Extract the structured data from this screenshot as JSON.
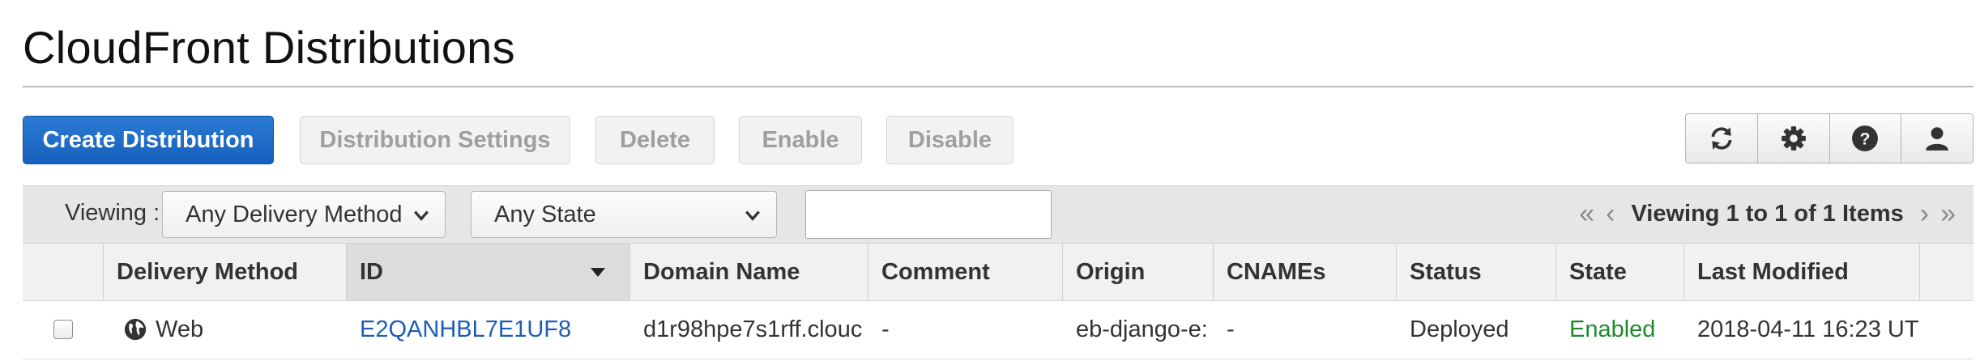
{
  "page": {
    "title": "CloudFront Distributions"
  },
  "toolbar": {
    "create_label": "Create Distribution",
    "settings_label": "Distribution Settings",
    "delete_label": "Delete",
    "enable_label": "Enable",
    "disable_label": "Disable",
    "icons": [
      "refresh-icon",
      "gear-icon",
      "help-icon",
      "user-icon"
    ]
  },
  "filter": {
    "viewing_label": "Viewing :",
    "delivery_method": "Any Delivery Method",
    "state": "Any State",
    "search_value": "",
    "pager_text": "Viewing 1 to 1 of 1 Items"
  },
  "table": {
    "columns": [
      "Delivery Method",
      "ID",
      "Domain Name",
      "Comment",
      "Origin",
      "CNAMEs",
      "Status",
      "State",
      "Last Modified"
    ],
    "sorted_column": "ID",
    "rows": [
      {
        "delivery_method": "Web",
        "id": "E2QANHBL7E1UF8",
        "domain_name": "d1r98hpe7s1rff.clouc",
        "comment": "-",
        "origin": "eb-django-e:",
        "cnames": "-",
        "status": "Deployed",
        "state": "Enabled",
        "last_modified": "2018-04-11 16:23 UT"
      }
    ]
  },
  "colors": {
    "primary_button": "#1a6ac6",
    "link": "#1d5cb8",
    "enabled_state": "#1f8a2c"
  }
}
